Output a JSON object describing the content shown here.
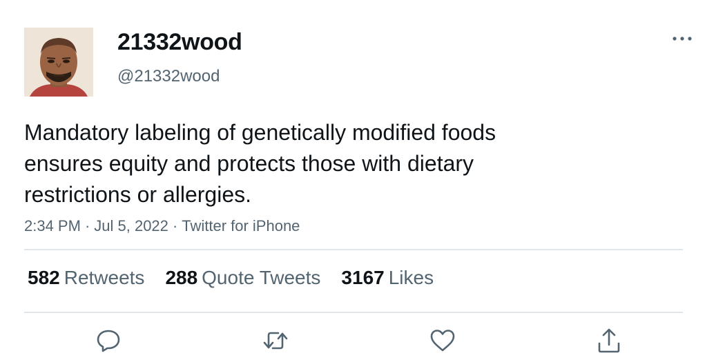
{
  "author": {
    "display_name": "21332wood",
    "handle": "@21332wood"
  },
  "tweet": {
    "text": "Mandatory labeling of genetically modified foods ensures equity and protects those with dietary restrictions or allergies.",
    "time": "2:34 PM",
    "date": "Jul 5, 2022",
    "source": "Twitter for iPhone"
  },
  "stats": {
    "retweets": {
      "count": "582",
      "label": "Retweets"
    },
    "quote_tweets": {
      "count": "288",
      "label": "Quote Tweets"
    },
    "likes": {
      "count": "3167",
      "label": "Likes"
    }
  },
  "separator": "·",
  "icons": {
    "more": "more-icon",
    "reply": "reply-icon",
    "retweet": "retweet-icon",
    "like": "heart-icon",
    "share": "share-icon"
  },
  "colors": {
    "text_primary": "#0f1419",
    "text_secondary": "#536471",
    "divider": "#e1e6ea",
    "icon": "#536471"
  }
}
